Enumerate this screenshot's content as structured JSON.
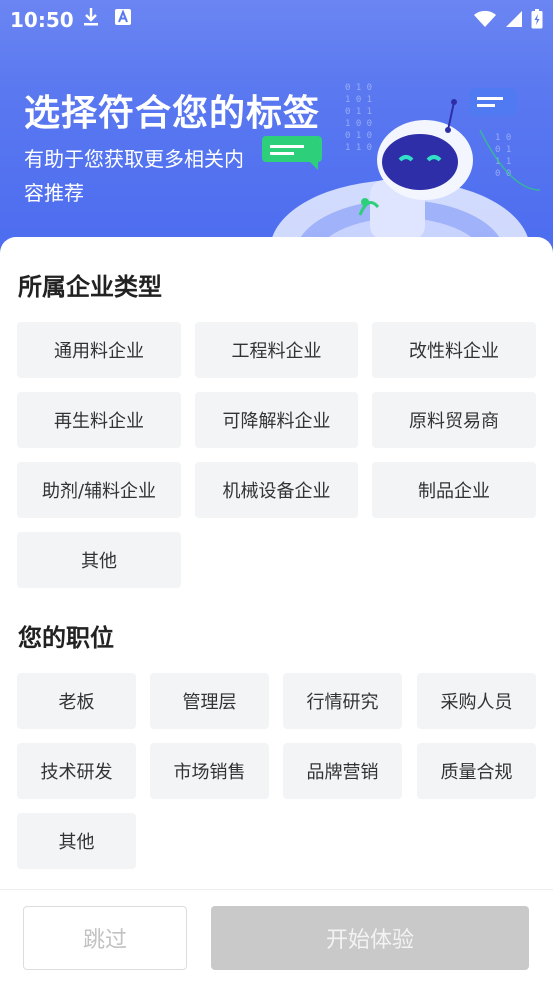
{
  "status": {
    "time": "10:50"
  },
  "hero": {
    "title": "选择符合您的标签",
    "subtitle": "有助于您获取更多相关内容推荐"
  },
  "company": {
    "title": "所属企业类型",
    "options": [
      "通用料企业",
      "工程料企业",
      "改性料企业",
      "再生料企业",
      "可降解料企业",
      "原料贸易商",
      "助剂/辅料企业",
      "机械设备企业",
      "制品企业",
      "其他"
    ]
  },
  "position": {
    "title": "您的职位",
    "options": [
      "老板",
      "管理层",
      "行情研究",
      "采购人员",
      "技术研发",
      "市场销售",
      "品牌营销",
      "质量合规",
      "其他"
    ]
  },
  "footer": {
    "skip_label": "跳过",
    "start_label": "开始体验"
  },
  "colors": {
    "hero": "#5a78f0",
    "chip_bg": "#f3f4f6",
    "disabled_button": "#c9c9c9"
  },
  "icons": [
    "download-icon",
    "app-notification-icon",
    "wifi-icon",
    "signal-icon",
    "battery-icon"
  ]
}
